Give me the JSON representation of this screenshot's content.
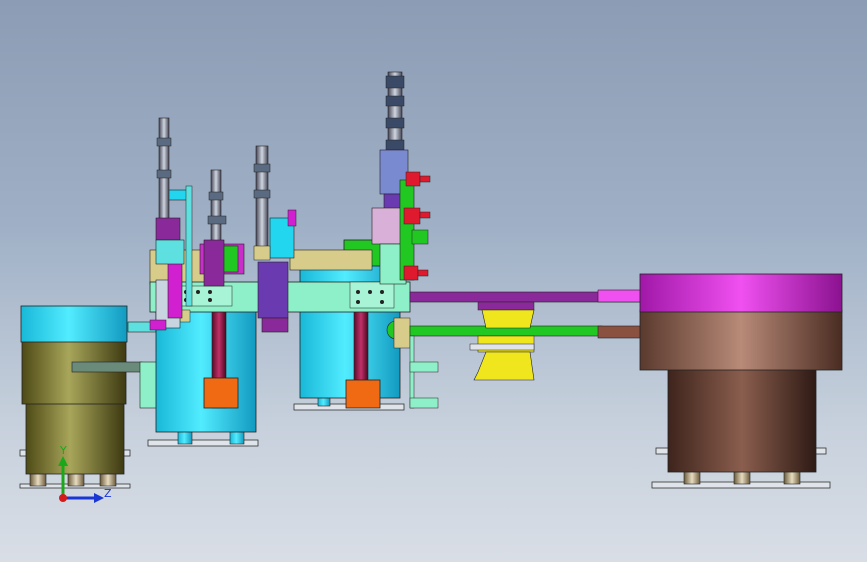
{
  "triad": {
    "y_label": "Y",
    "z_label": "Z",
    "colors": {
      "y": "#1aa81a",
      "z": "#1a36d4",
      "origin": "#d41a1a"
    }
  },
  "palette": {
    "cyan": "#22d6f0",
    "olive": "#7d7a2c",
    "bronze": "#8a6050",
    "magenta": "#d020d0",
    "purple": "#8a2a9a",
    "green": "#22c822",
    "yellow": "#f0e61e",
    "orange": "#f06a14",
    "mint": "#8ef0c8",
    "sand": "#d8cc8a"
  }
}
